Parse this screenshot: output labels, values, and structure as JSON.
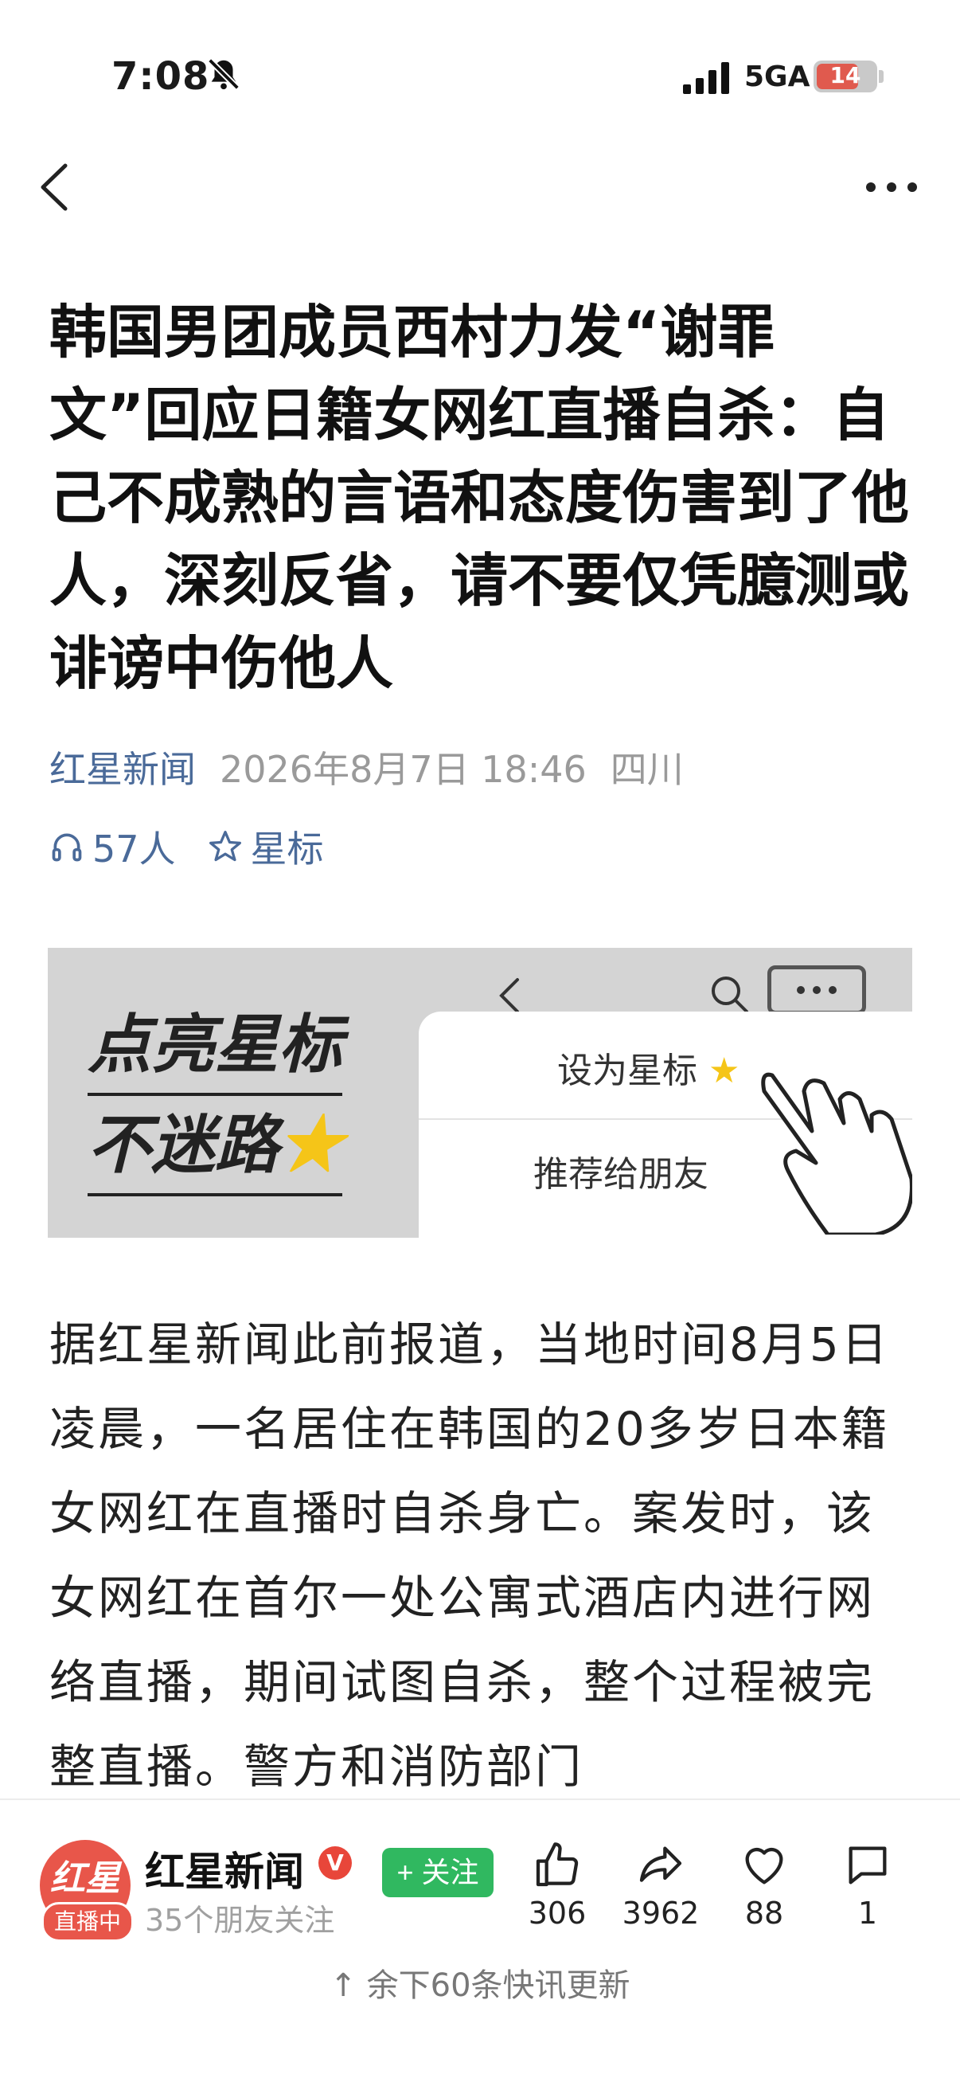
{
  "status_bar": {
    "time": "7:08",
    "network": "5GA",
    "battery": "14"
  },
  "article": {
    "title": "韩国男团成员西村力发“谢罪文”回应日籍女网红直播自杀：自己不成熟的言语和态度伤害到了他人，深刻反省，请不要仅凭臆测或诽谤中伤他人",
    "source": "红星新闻",
    "date": "2026年8月7日 18:46",
    "location": "四川",
    "listeners": "57人",
    "star_label": "星标",
    "body": "据红星新闻此前报道，当地时间8月5日凌晨，一名居住在韩国的20多岁日本籍女网红在直播时自杀身亡。案发时，该女网红在首尔一处公寓式酒店内进行网络直播，期间试图自杀，整个过程被完整直播。警方和消防部门"
  },
  "banner": {
    "line1": "点亮星标",
    "line2": "不迷路",
    "menu_item1": "设为星标",
    "menu_item2": "推荐给朋友"
  },
  "bottom_bar": {
    "account_name": "红星新闻",
    "verified": "V",
    "avatar_logo": "红星",
    "live_label": "直播中",
    "followers": "35个朋友关注",
    "follow_label": "+ 关注",
    "likes": "306",
    "shares": "3962",
    "favorites": "88",
    "comments": "1",
    "more_news": "↑ 余下60条快讯更新"
  },
  "colors": {
    "accent_blue": "#4a6a99",
    "follow_green": "#30b860",
    "brand_red": "#e8564a"
  },
  "icons": [
    "bell-slash-icon",
    "signal-icon",
    "back-icon",
    "more-icon",
    "headphones-icon",
    "star-icon",
    "thumbs-up-icon",
    "share-icon",
    "heart-icon",
    "comment-icon"
  ]
}
